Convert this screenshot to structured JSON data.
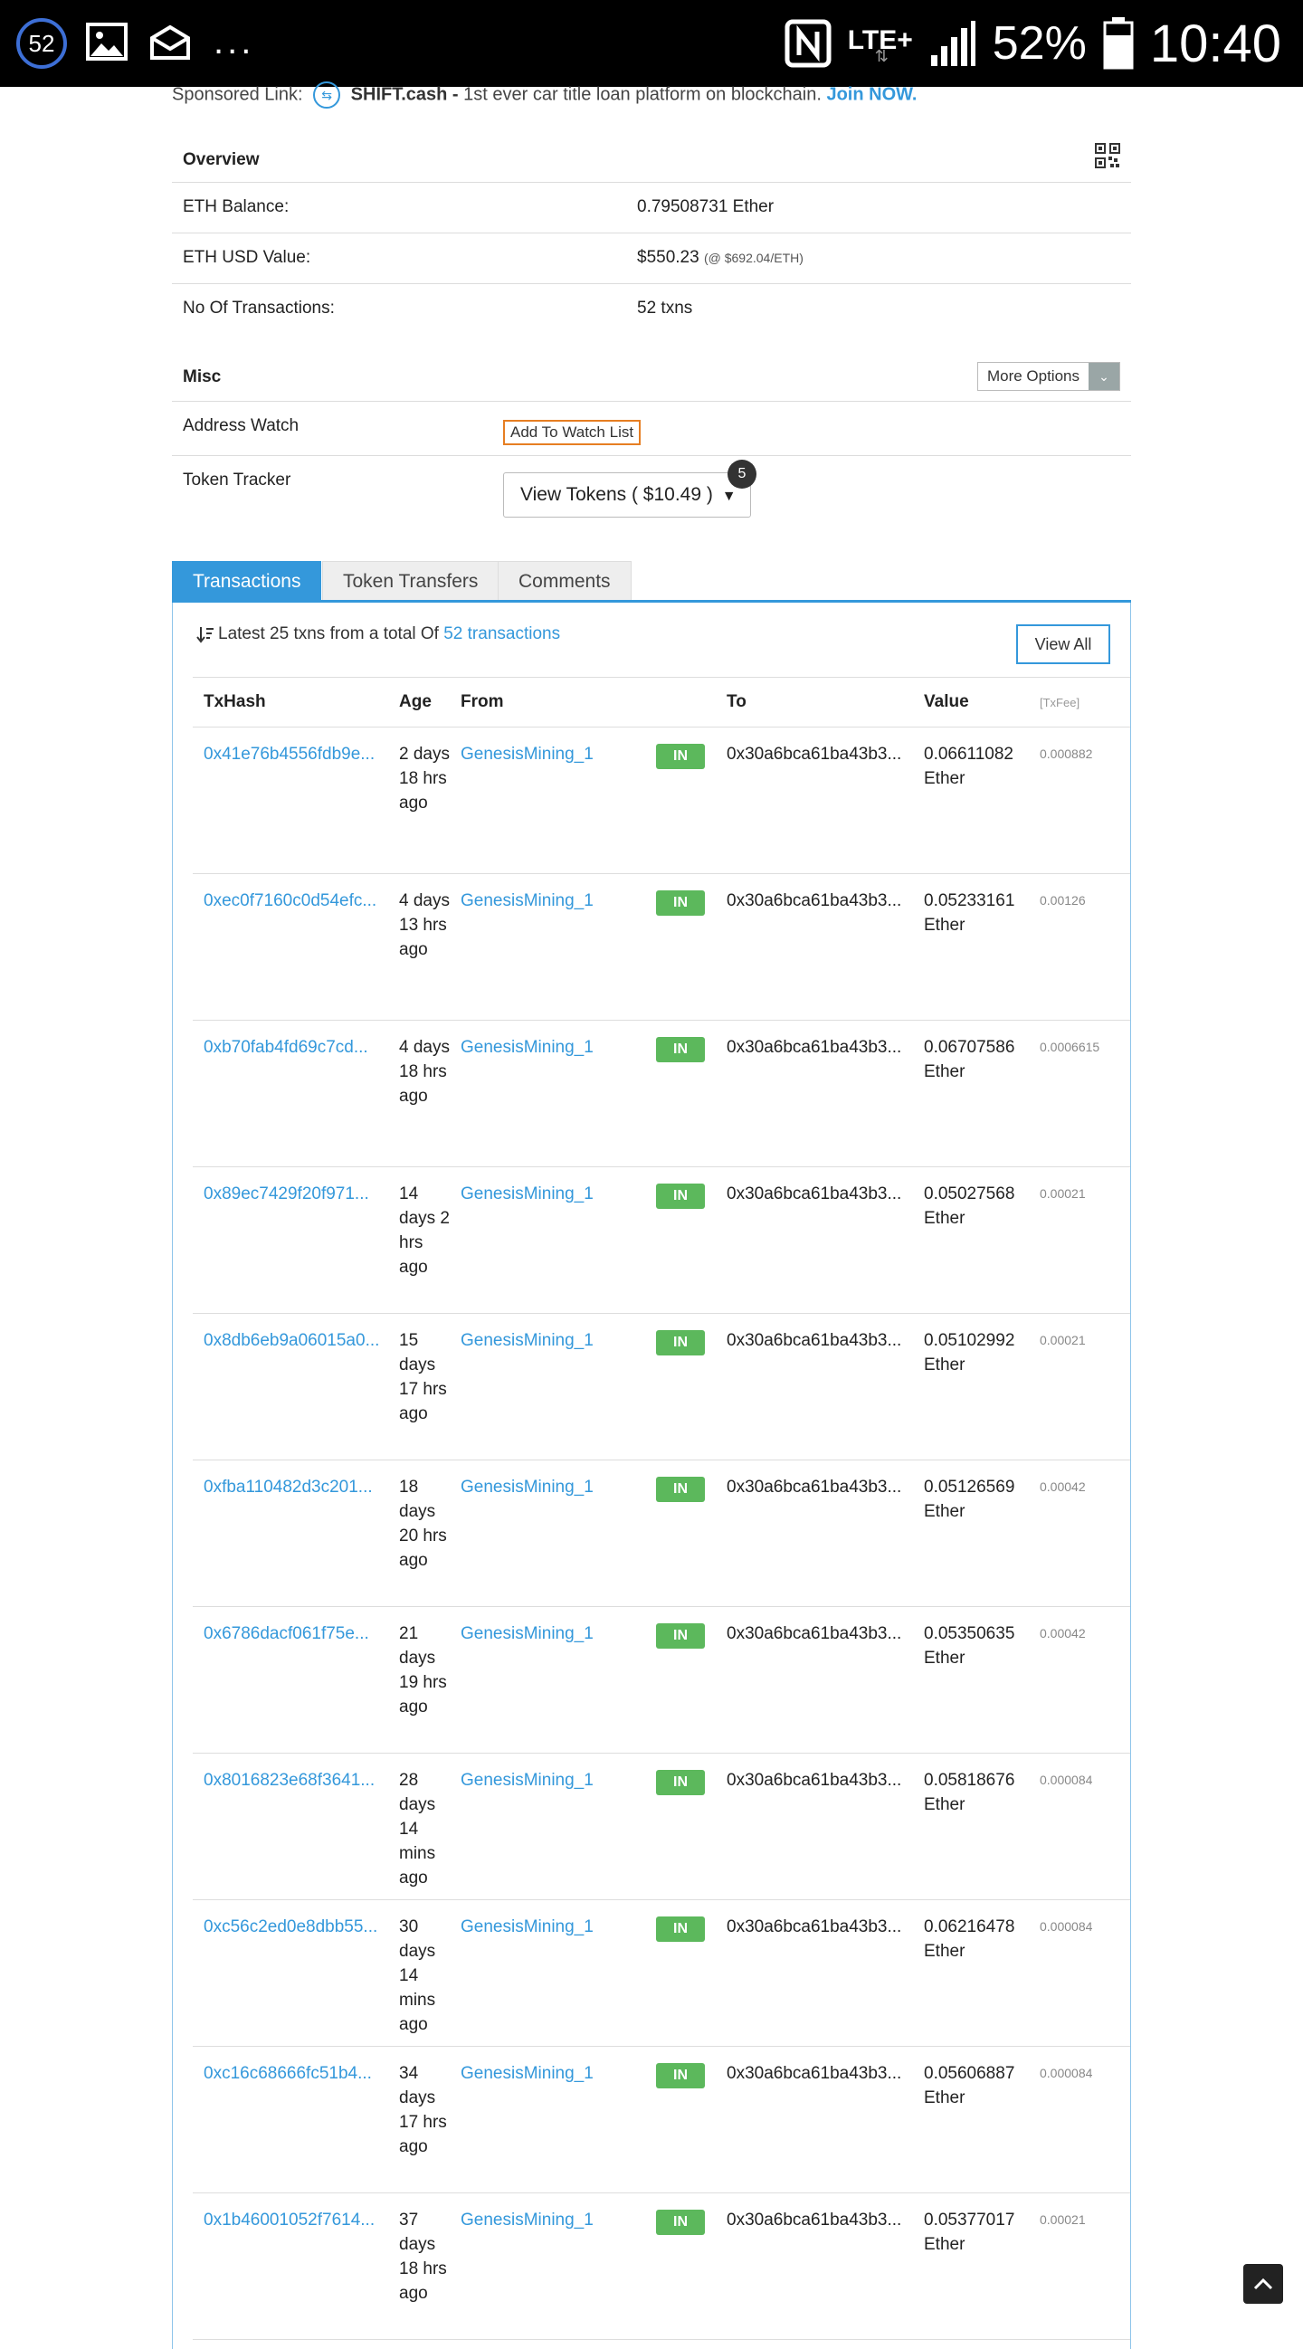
{
  "status_bar": {
    "notif_count": "52",
    "dots": "...",
    "lte": "LTE+",
    "battery": "52%",
    "time": "10:40"
  },
  "sponsored": {
    "prefix": "Sponsored Link:",
    "brand": "SHIFT.cash -",
    "text": " 1st ever car title loan platform on blockchain.",
    "cta": "Join NOW."
  },
  "overview": {
    "title": "Overview",
    "eth_balance_label": "ETH Balance:",
    "eth_balance_value": "0.79508731 Ether",
    "usd_label": "ETH USD Value:",
    "usd_value": "$550.23",
    "usd_rate": "(@ $692.04/ETH)",
    "txns_label": "No Of Transactions:",
    "txns_value": "52 txns"
  },
  "misc": {
    "title": "Misc",
    "more_options": "More Options",
    "address_watch_label": "Address Watch",
    "watch_button": "Add To Watch List",
    "token_tracker_label": "Token Tracker",
    "tokens_button": "View Tokens ( $10.49 )",
    "tokens_badge": "5"
  },
  "tabs": [
    {
      "label": "Transactions"
    },
    {
      "label": "Token Transfers"
    },
    {
      "label": "Comments"
    }
  ],
  "transactions": {
    "latest_prefix": "Latest 25 txns from a total Of ",
    "latest_link": "52 transactions",
    "view_all": "View All",
    "headers": {
      "hash": "TxHash",
      "age": "Age",
      "from": "From",
      "to": "To",
      "value": "Value",
      "fee": "[TxFee]"
    },
    "rows": [
      {
        "hash": "0x41e76b4556fdb9e...",
        "age": "2 days 18 hrs ago",
        "from": "GenesisMining_1",
        "dir": "IN",
        "to": "0x30a6bca61ba43b3...",
        "value": "0.06611082 Ether",
        "fee": "0.000882"
      },
      {
        "hash": "0xec0f7160c0d54efc...",
        "age": "4 days 13 hrs ago",
        "from": "GenesisMining_1",
        "dir": "IN",
        "to": "0x30a6bca61ba43b3...",
        "value": "0.05233161 Ether",
        "fee": "0.00126"
      },
      {
        "hash": "0xb70fab4fd69c7cd...",
        "age": "4 days 18 hrs ago",
        "from": "GenesisMining_1",
        "dir": "IN",
        "to": "0x30a6bca61ba43b3...",
        "value": "0.06707586 Ether",
        "fee": "0.0006615"
      },
      {
        "hash": "0x89ec7429f20f971...",
        "age": "14 days 2 hrs ago",
        "from": "GenesisMining_1",
        "dir": "IN",
        "to": "0x30a6bca61ba43b3...",
        "value": "0.05027568 Ether",
        "fee": "0.00021"
      },
      {
        "hash": "0x8db6eb9a06015a0...",
        "age": "15 days 17 hrs ago",
        "from": "GenesisMining_1",
        "dir": "IN",
        "to": "0x30a6bca61ba43b3...",
        "value": "0.05102992 Ether",
        "fee": "0.00021"
      },
      {
        "hash": "0xfba110482d3c201...",
        "age": "18 days 20 hrs ago",
        "from": "GenesisMining_1",
        "dir": "IN",
        "to": "0x30a6bca61ba43b3...",
        "value": "0.05126569 Ether",
        "fee": "0.00042"
      },
      {
        "hash": "0x6786dacf061f75e...",
        "age": "21 days 19 hrs ago",
        "from": "GenesisMining_1",
        "dir": "IN",
        "to": "0x30a6bca61ba43b3...",
        "value": "0.05350635 Ether",
        "fee": "0.00042"
      },
      {
        "hash": "0x8016823e68f3641...",
        "age": "28 days 14 mins ago",
        "from": "GenesisMining_1",
        "dir": "IN",
        "to": "0x30a6bca61ba43b3...",
        "value": "0.05818676 Ether",
        "fee": "0.000084"
      },
      {
        "hash": "0xc56c2ed0e8dbb55...",
        "age": "30 days 14 mins ago",
        "from": "GenesisMining_1",
        "dir": "IN",
        "to": "0x30a6bca61ba43b3...",
        "value": "0.06216478 Ether",
        "fee": "0.000084"
      },
      {
        "hash": "0xc16c68666fc51b4...",
        "age": "34 days 17 hrs ago",
        "from": "GenesisMining_1",
        "dir": "IN",
        "to": "0x30a6bca61ba43b3...",
        "value": "0.05606887 Ether",
        "fee": "0.000084"
      },
      {
        "hash": "0x1b46001052f7614...",
        "age": "37 days 18 hrs ago",
        "from": "GenesisMining_1",
        "dir": "IN",
        "to": "0x30a6bca61ba43b3...",
        "value": "0.05377017 Ether",
        "fee": "0.00021"
      }
    ]
  }
}
